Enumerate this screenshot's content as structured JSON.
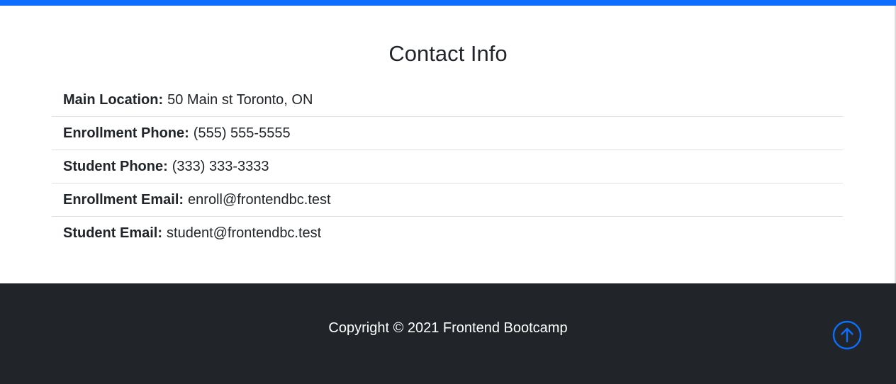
{
  "contact": {
    "title": "Contact Info",
    "items": [
      {
        "label": "Main Location:",
        "value": "50 Main st Toronto, ON"
      },
      {
        "label": "Enrollment Phone:",
        "value": "(555) 555-5555"
      },
      {
        "label": "Student Phone:",
        "value": "(333) 333-3333"
      },
      {
        "label": "Enrollment Email:",
        "value": "enroll@frontendbc.test"
      },
      {
        "label": "Student Email:",
        "value": "student@frontendbc.test"
      }
    ]
  },
  "footer": {
    "copyright": "Copyright © 2021 Frontend Bootcamp",
    "back_to_top_icon": "arrow-up-circle-icon"
  },
  "colors": {
    "accent": "#0d6efd",
    "footer_bg": "#212529",
    "text": "#212529",
    "divider": "#dee2e6"
  }
}
